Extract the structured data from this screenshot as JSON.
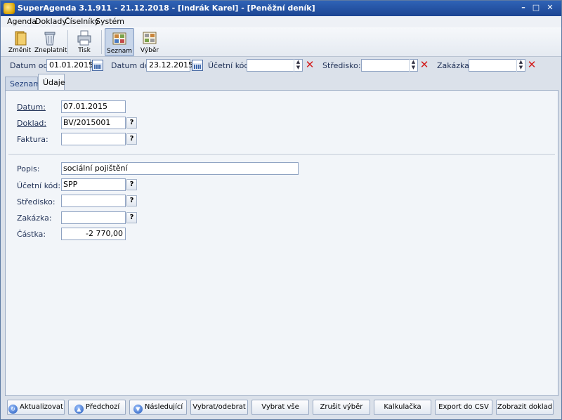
{
  "window": {
    "title": "SuperAgenda 3.1.911 - 21.12.2018 - [Indrák Karel] - [Peněžní deník]"
  },
  "menu": [
    "Agenda",
    "Doklady",
    "Číselníky",
    "Systém"
  ],
  "toolbar": {
    "zmenit": "Změnit",
    "zneplatnit": "Zneplatnit",
    "tisk": "Tisk",
    "seznam": "Seznam",
    "vyber": "Výběr"
  },
  "filters": {
    "datum_od_label": "Datum od:",
    "datum_od_value": "01.01.2015",
    "datum_do_label": "Datum do:",
    "datum_do_value": "23.12.2015",
    "ucetni_kod_label": "Účetní kód:",
    "ucetni_kod_value": "",
    "stredisko_label": "Středisko:",
    "stredisko_value": "",
    "zakazka_label": "Zakázka:",
    "zakazka_value": ""
  },
  "tabs": {
    "seznam": "Seznam",
    "udaje": "Údaje"
  },
  "form": {
    "datum_label": "Datum:",
    "datum_value": "07.01.2015",
    "doklad_label": "Doklad:",
    "doklad_value": "BV/2015001",
    "faktura_label": "Faktura:",
    "faktura_value": "",
    "popis_label": "Popis:",
    "popis_value": "sociální pojištění",
    "ucetni_kod_label": "Účetní kód:",
    "ucetni_kod_value": "SPP",
    "stredisko_label": "Středisko:",
    "stredisko_value": "",
    "zakazka_label": "Zakázka:",
    "zakazka_value": "",
    "castka_label": "Částka:",
    "castka_value": "-2 770,00",
    "lookup": "?"
  },
  "bottom": {
    "aktualizovat": "Aktualizovat",
    "predchozi": "Předchozí",
    "nasledujici": "Následující",
    "vybrat_odebrat": "Vybrat/odebrat",
    "vybrat_vse": "Vybrat vše",
    "zrusit_vyber": "Zrušit výběr",
    "kalkulacka": "Kalkulačka",
    "export_csv": "Export do CSV",
    "zobrazit_doklad": "Zobrazit doklad"
  }
}
